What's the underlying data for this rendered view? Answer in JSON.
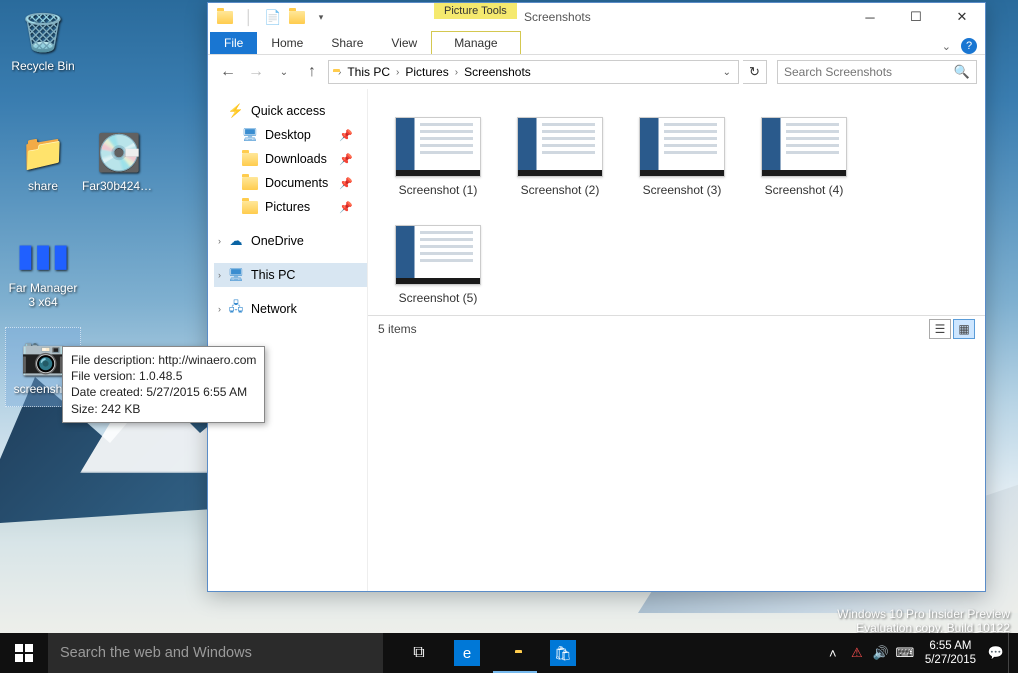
{
  "desktop": {
    "icons": [
      {
        "label": "Recycle Bin"
      },
      {
        "label": "share"
      },
      {
        "label": "Far30b4242...."
      },
      {
        "label": "Far Manager 3 x64"
      },
      {
        "label": "screenshot"
      }
    ]
  },
  "tooltip": {
    "line1": "File description: http://winaero.com",
    "line2": "File version: 1.0.48.5",
    "line3": "Date created: 5/27/2015 6:55 AM",
    "line4": "Size: 242 KB"
  },
  "explorer": {
    "context_tab": "Picture Tools",
    "title": "Screenshots",
    "tabs": {
      "file": "File",
      "home": "Home",
      "share": "Share",
      "view": "View",
      "manage": "Manage"
    },
    "breadcrumb": {
      "root": "This PC",
      "p1": "Pictures",
      "p2": "Screenshots"
    },
    "search_placeholder": "Search Screenshots",
    "sidebar": {
      "quick": "Quick access",
      "desktop": "Desktop",
      "downloads": "Downloads",
      "documents": "Documents",
      "pictures": "Pictures",
      "onedrive": "OneDrive",
      "thispc": "This PC",
      "network": "Network"
    },
    "files": [
      {
        "name": "Screenshot (1)"
      },
      {
        "name": "Screenshot (2)"
      },
      {
        "name": "Screenshot (3)"
      },
      {
        "name": "Screenshot (4)"
      },
      {
        "name": "Screenshot (5)"
      }
    ],
    "status": "5 items"
  },
  "watermark": {
    "line1": "Windows 10 Pro Insider Preview",
    "line2": "Evaluation copy. Build 10122"
  },
  "taskbar": {
    "search_placeholder": "Search the web and Windows",
    "time": "6:55 AM",
    "date": "5/27/2015"
  }
}
